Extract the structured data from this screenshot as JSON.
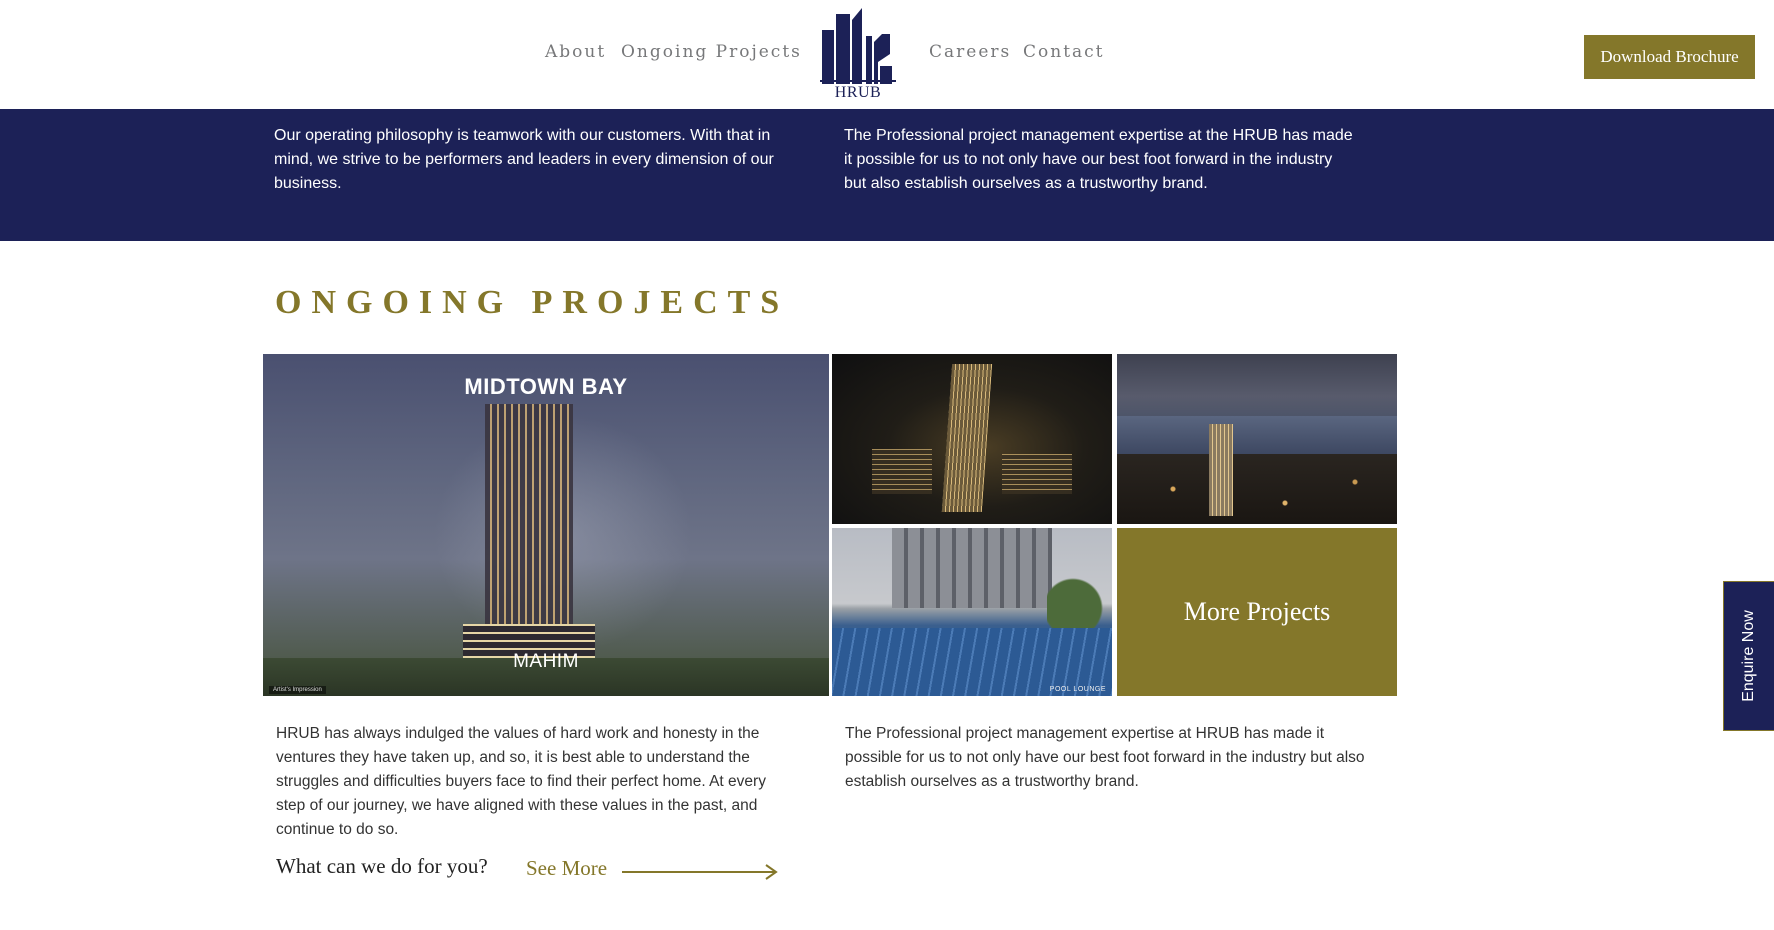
{
  "brand": {
    "logo_text": "HRUB",
    "primary_color": "#1c2157",
    "accent_color": "#84772a"
  },
  "nav": {
    "left": [
      {
        "label": "About"
      },
      {
        "label": "Ongoing Projects"
      }
    ],
    "right": [
      {
        "label": "Careers"
      },
      {
        "label": "Contact"
      }
    ]
  },
  "header": {
    "download_label": "Download Brochure"
  },
  "band": {
    "left_text": "Our operating philosophy is teamwork with our customers. With that in mind, we strive to be performers and leaders in every dimension of our business.",
    "right_text": "The Professional project management expertise at the HRUB has made it possible for us to not only have our best foot forward in the industry but also establish ourselves as a trustworthy brand."
  },
  "section": {
    "title": "ONGOING PROJECTS"
  },
  "gallery": {
    "main": {
      "title": "MIDTOWN BAY",
      "location": "MAHIM",
      "fine_print": "Artist's Impression"
    },
    "pool_label": "POOL LOUNGE",
    "more_label": "More Projects"
  },
  "body": {
    "left_text": "HRUB has always indulged the values of hard work and honesty in the ventures they have taken up, and so, it is best able to understand the struggles and difficulties buyers face to find their perfect home. At every step of our journey, we have aligned with these values in the past, and continue to do so.",
    "right_text": "The Professional project management expertise at HRUB has made it possible for us to not only have our best foot forward in the industry but also establish ourselves as a trustworthy brand.",
    "question": "What can we do for you?",
    "see_more_label": "See More"
  },
  "enquire": {
    "label": "Enquire Now"
  }
}
